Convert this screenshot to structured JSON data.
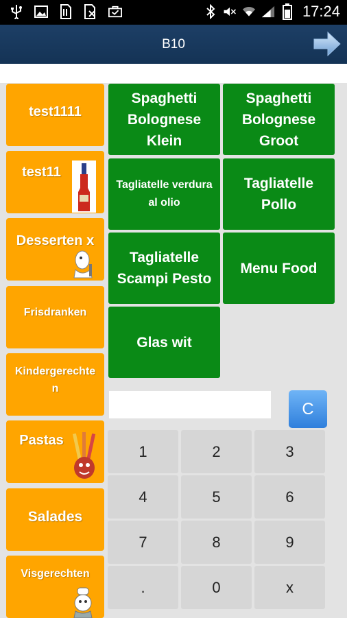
{
  "status_bar": {
    "time": "17:24"
  },
  "titlebar": {
    "title": "B10"
  },
  "categories": [
    {
      "label": "test1111"
    },
    {
      "label": "test11"
    },
    {
      "label": "Desserten x"
    },
    {
      "label": "Frisdranken"
    },
    {
      "label": "Kindergerechten"
    },
    {
      "label": "Pastas"
    },
    {
      "label": "Salades"
    },
    {
      "label": "Visgerechten"
    }
  ],
  "products": [
    {
      "label": "Spaghetti Bolognese Klein"
    },
    {
      "label": "Spaghetti Bolognese Groot"
    },
    {
      "label": "Tagliatelle verdura al olio"
    },
    {
      "label": "Tagliatelle Pollo"
    },
    {
      "label": "Tagliatelle Scampi Pesto"
    },
    {
      "label": "Menu Food"
    },
    {
      "label": "Glas wit"
    }
  ],
  "keypad": {
    "clear_label": "C",
    "display_value": "",
    "keys": [
      "1",
      "2",
      "3",
      "4",
      "5",
      "6",
      "7",
      "8",
      "9",
      ".",
      "0",
      "x"
    ]
  },
  "colors": {
    "category": "#ffa500",
    "product": "#0a8a16",
    "titlebar": "#1d3f66",
    "clear_button": "#3a8be6"
  }
}
